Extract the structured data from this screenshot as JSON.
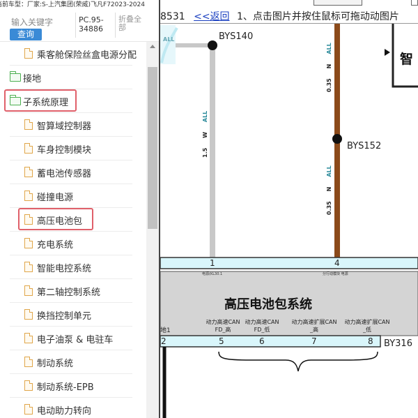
{
  "top_bar": {
    "vehicle": "当前车型：厂家:S-上汽集团(荣威)飞凡F72023-2024"
  },
  "search": {
    "hint": "输入关键字",
    "button": "查询",
    "code": "PC.95-34886",
    "collapse": "折叠全部"
  },
  "tree": {
    "items": [
      {
        "label": "乘客舱保险丝盒电源分配",
        "kind": "file",
        "level": 1
      },
      {
        "label": "接地",
        "kind": "folder",
        "level": 0
      },
      {
        "label": "子系统原理",
        "kind": "folder",
        "level": 0,
        "highlighted": true
      },
      {
        "label": "智算域控制器",
        "kind": "file",
        "level": 1
      },
      {
        "label": "车身控制模块",
        "kind": "file",
        "level": 1
      },
      {
        "label": "蓄电池传感器",
        "kind": "file",
        "level": 1
      },
      {
        "label": "碰撞电源",
        "kind": "file",
        "level": 1
      },
      {
        "label": "高压电池包",
        "kind": "file",
        "level": 1,
        "highlighted": true
      },
      {
        "label": "充电系统",
        "kind": "file",
        "level": 1
      },
      {
        "label": "智能电控系统",
        "kind": "file",
        "level": 1
      },
      {
        "label": "第二轴控制系统",
        "kind": "file",
        "level": 1
      },
      {
        "label": "换挡控制单元",
        "kind": "file",
        "level": 1
      },
      {
        "label": "电子油泵 & 电驻车",
        "kind": "file",
        "level": 1
      },
      {
        "label": "制动系统",
        "kind": "file",
        "level": 1
      },
      {
        "label": "制动系统-EPB",
        "kind": "file",
        "level": 1
      },
      {
        "label": "电动助力转向",
        "kind": "file",
        "level": 1
      }
    ]
  },
  "viewer": {
    "doc_number": "8531",
    "back_link": "<<返回",
    "instruction": "1、点击图片并按住鼠标可拖动动图片"
  },
  "diagram": {
    "splice_1": "BYS140",
    "splice_2": "BYS152",
    "wire_1": {
      "size": "1.5",
      "color": "W",
      "option": "ALL",
      "color_hex": "#c8c8c8"
    },
    "wire_2_upper": {
      "size": "0.35",
      "color": "N",
      "option": "ALL",
      "color_hex": "#8b4a1a"
    },
    "wire_2_lower": {
      "size": "0.35",
      "color": "N",
      "option": "ALL"
    },
    "corner_label": "ALL",
    "partial_box": "智",
    "connector_top_pins": [
      "1",
      "4"
    ],
    "pin_1_small": "电源(KL30.1",
    "pin_4_small": "分行动模块 电源",
    "module_name": "高压电池包系统",
    "left_partial": "地1",
    "signals": [
      {
        "l1": "动力高速CAN",
        "l2": "FD_高"
      },
      {
        "l1": "动力高速CAN",
        "l2": "FD_低"
      },
      {
        "l1": "动力高速扩展CAN",
        "l2": "_高"
      },
      {
        "l1": "动力高速扩展CAN",
        "l2": "_低"
      }
    ],
    "connector_bottom_pins": [
      "2",
      "5",
      "6",
      "7",
      "8"
    ],
    "connector_id": "BY316",
    "accent_hex": "#d9f6fb"
  }
}
